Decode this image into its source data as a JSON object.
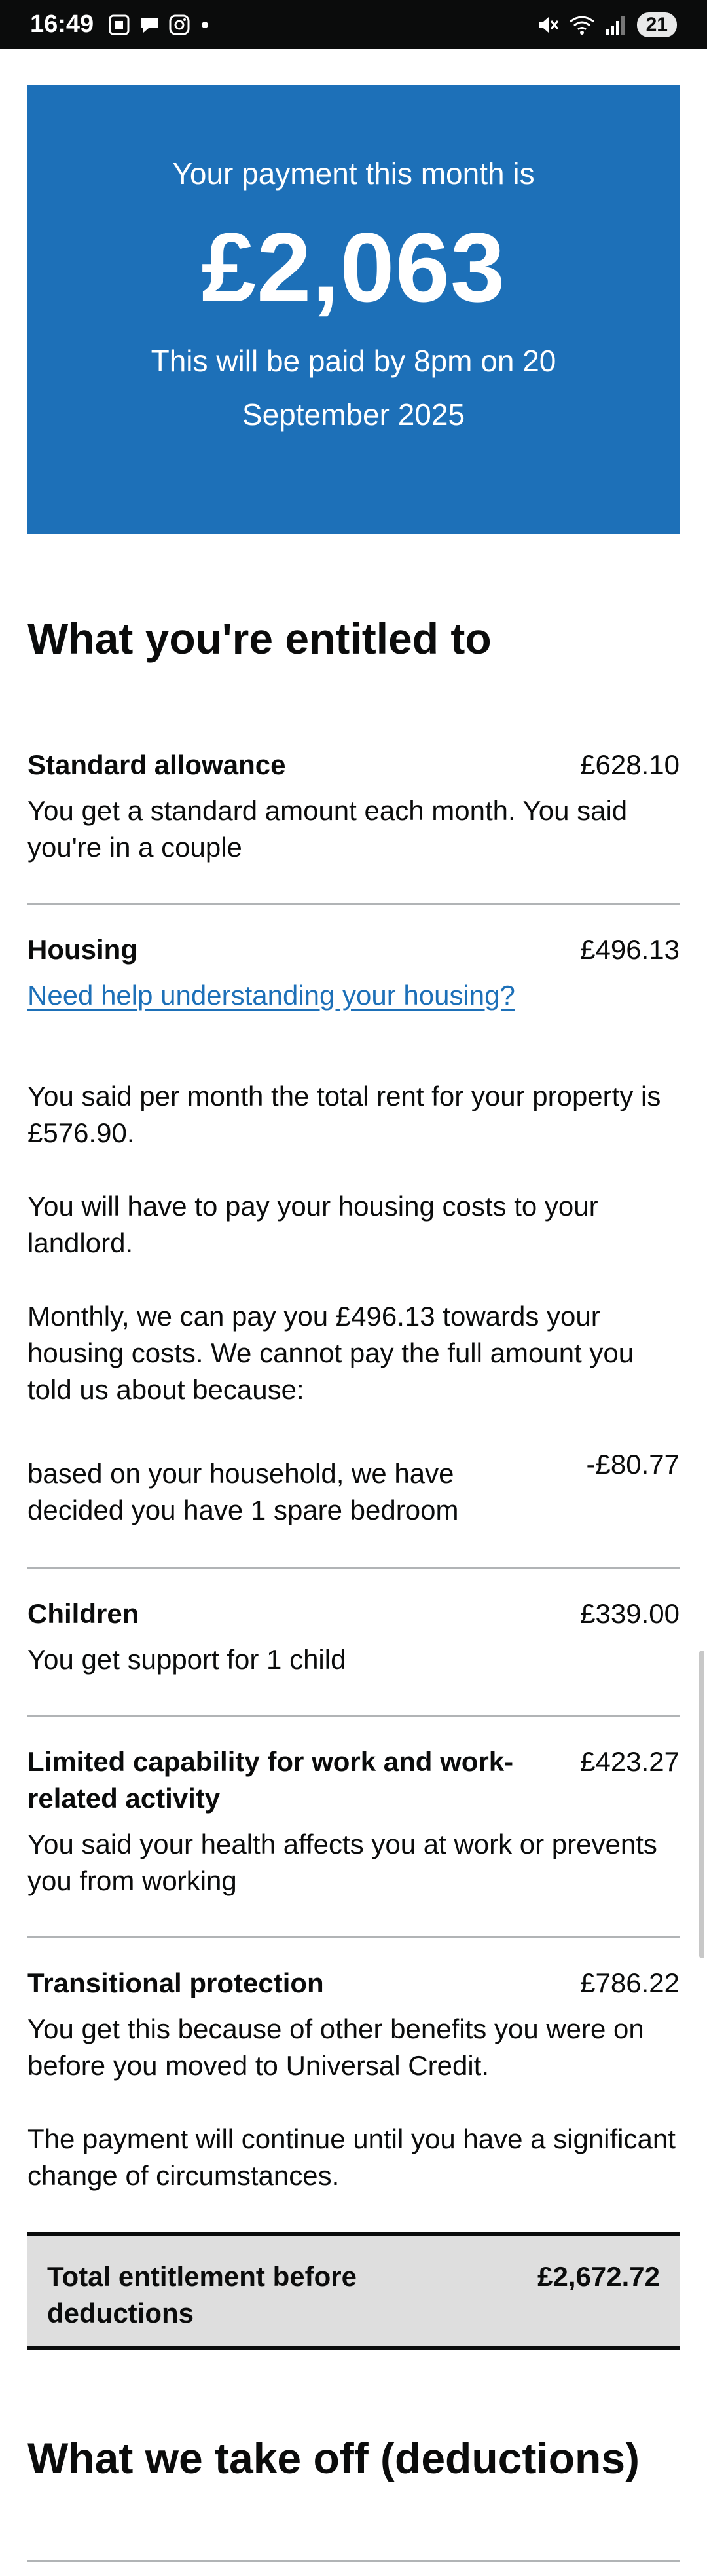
{
  "status_bar": {
    "time": "16:49",
    "battery": "21",
    "icons_left": [
      "screenshot-icon",
      "chat-icon",
      "instagram-icon",
      "dot-icon"
    ],
    "icons_right": [
      "mute-icon",
      "wifi-icon",
      "signal-icon"
    ]
  },
  "hero": {
    "line1": "Your payment this month is",
    "amount": "£2,063",
    "sub": "This will be paid by 8pm on 20 September 2025",
    "bg_color": "#1d70b8"
  },
  "entitled": {
    "heading": "What you're entitled to",
    "rows": [
      {
        "title": "Standard allowance",
        "amount": "£628.10",
        "desc": "You get a standard amount each month. You said you're in a couple"
      },
      {
        "title": "Housing",
        "amount": "£496.13",
        "link": "Need help understanding your housing?",
        "p1": "You said per month the total rent for your property is £576.90.",
        "p2": "You will have to pay your housing costs to your landlord.",
        "p3": "Monthly, we can pay you £496.13 towards your housing costs. We cannot pay the full amount you told us about because:",
        "reduction_text": "based on your household, we have decided you have 1 spare bedroom",
        "reduction_amount": "-£80.77"
      },
      {
        "title": "Children",
        "amount": "£339.00",
        "desc": "You get support for 1 child"
      },
      {
        "title": "Limited capability for work and work-related activity",
        "amount": "£423.27",
        "desc": "You said your health affects you at work or prevents you from working"
      },
      {
        "title": "Transitional protection",
        "amount": "£786.22",
        "desc": "You get this because of other benefits you were on before you moved to Universal Credit.",
        "desc2": "The payment will continue until you have a significant change of circumstances."
      }
    ],
    "total_label": "Total entitlement before deductions",
    "total_amount": "£2,672.72"
  },
  "deductions": {
    "heading": "What we take off (deductions)"
  }
}
